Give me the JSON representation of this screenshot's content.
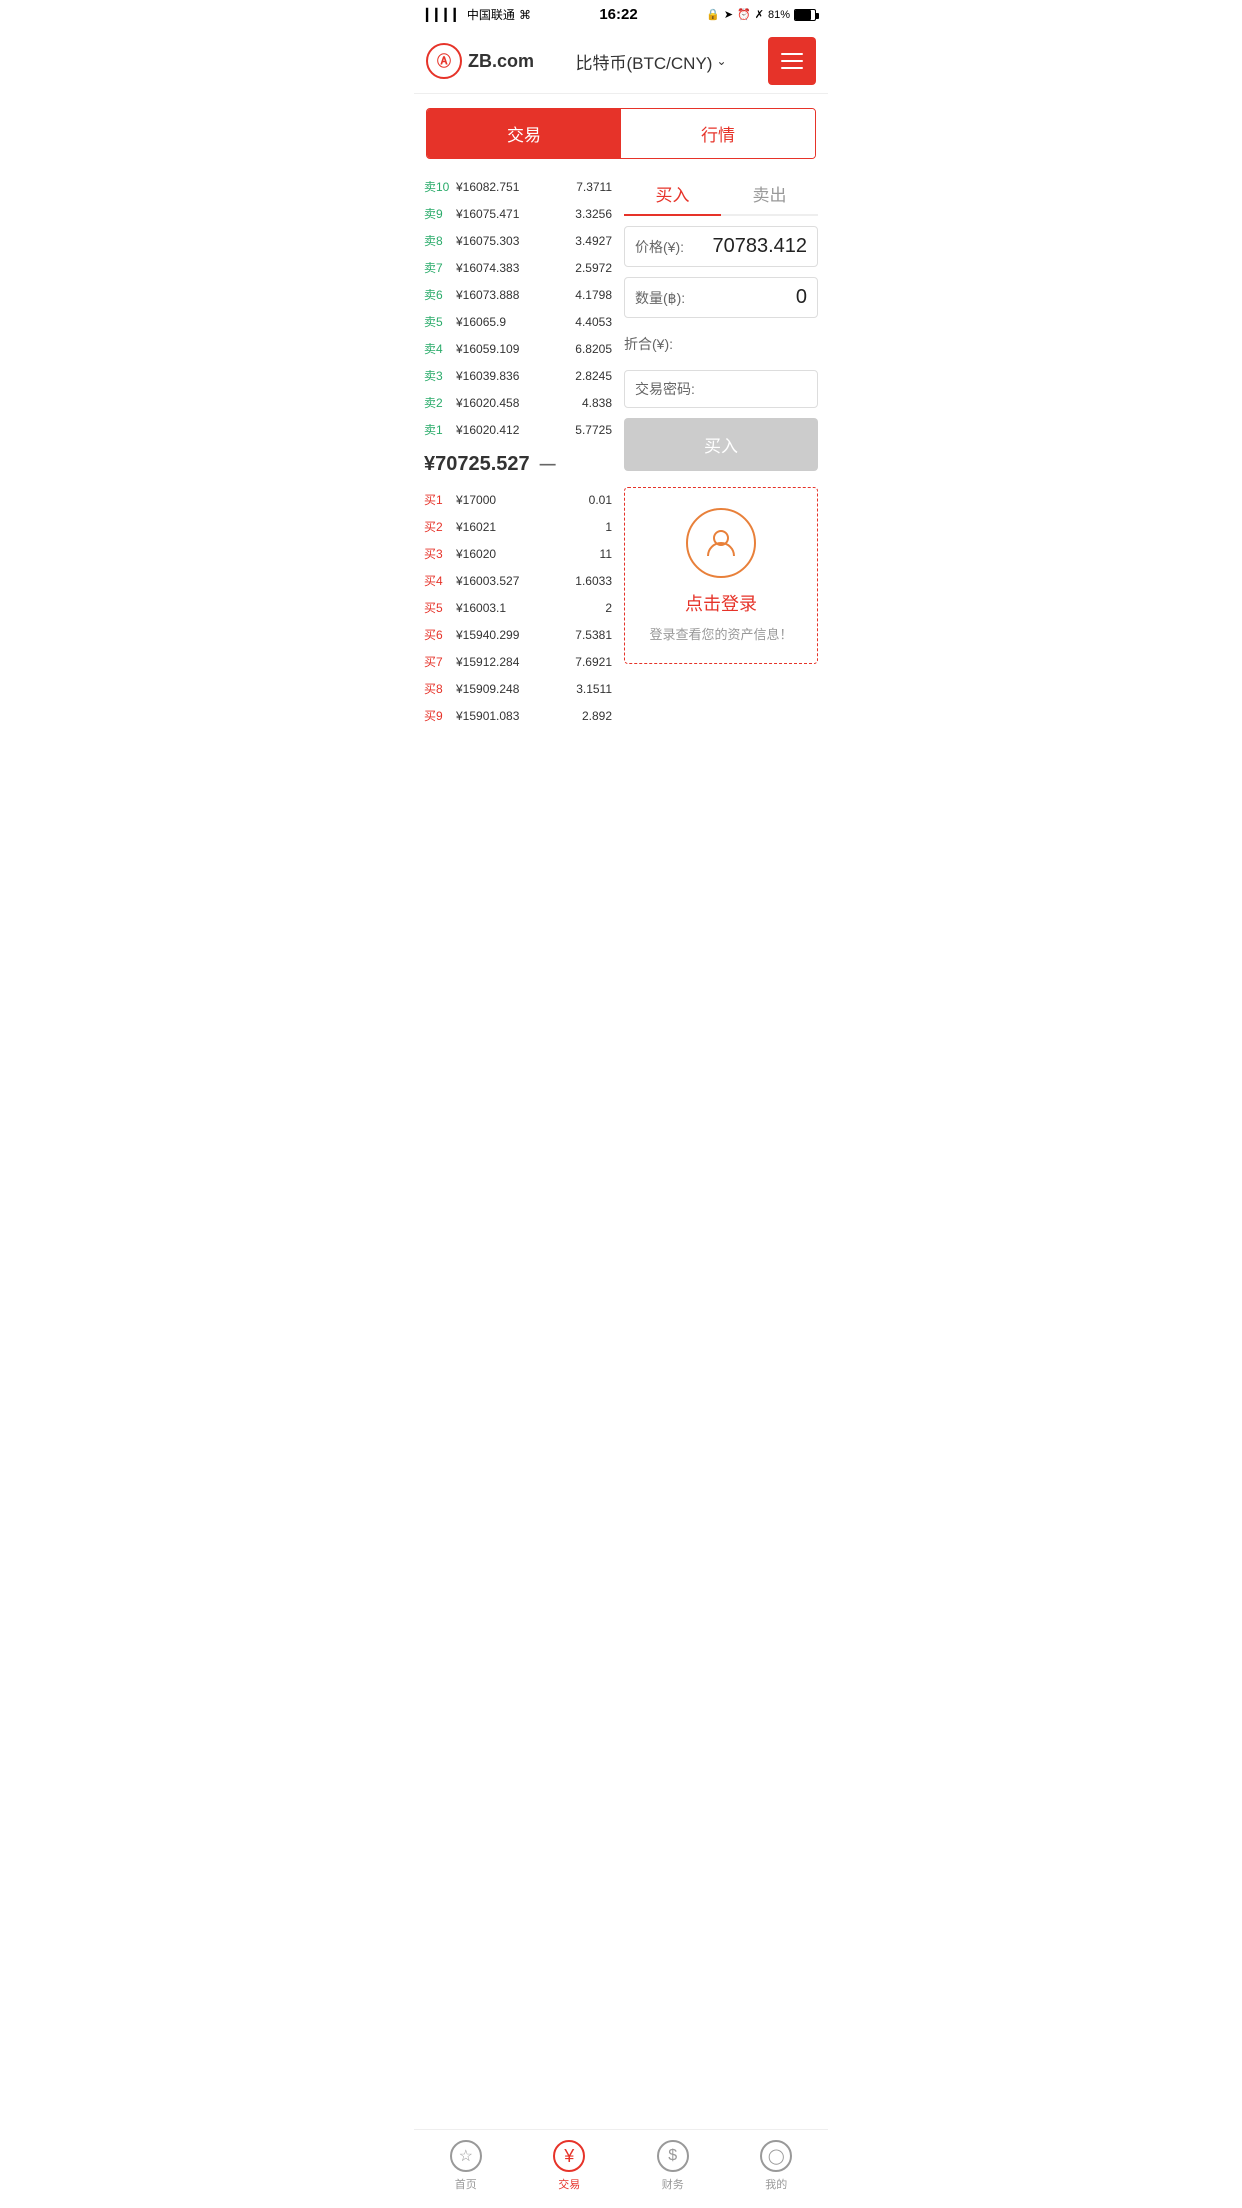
{
  "statusBar": {
    "carrier": "中国联通",
    "time": "16:22",
    "battery": "81%"
  },
  "header": {
    "logoText": "ZB",
    "logoDomain": ".com",
    "title": "比特币(BTC/CNY)",
    "menuLabel": "menu"
  },
  "tabs": {
    "trade": "交易",
    "market": "行情"
  },
  "sellOrders": [
    {
      "label": "卖10",
      "price": "¥16082.751",
      "qty": "7.3711"
    },
    {
      "label": "卖9",
      "price": "¥16075.471",
      "qty": "3.3256"
    },
    {
      "label": "卖8",
      "price": "¥16075.303",
      "qty": "3.4927"
    },
    {
      "label": "卖7",
      "price": "¥16074.383",
      "qty": "2.5972"
    },
    {
      "label": "卖6",
      "price": "¥16073.888",
      "qty": "4.1798"
    },
    {
      "label": "卖5",
      "price": "¥16065.9",
      "qty": "4.4053"
    },
    {
      "label": "卖4",
      "price": "¥16059.109",
      "qty": "6.8205"
    },
    {
      "label": "卖3",
      "price": "¥16039.836",
      "qty": "2.8245"
    },
    {
      "label": "卖2",
      "price": "¥16020.458",
      "qty": "4.838"
    },
    {
      "label": "卖1",
      "price": "¥16020.412",
      "qty": "5.7725"
    }
  ],
  "midPrice": {
    "value": "¥70725.527",
    "arrow": "—"
  },
  "buyOrders": [
    {
      "label": "买1",
      "price": "¥17000",
      "qty": "0.01"
    },
    {
      "label": "买2",
      "price": "¥16021",
      "qty": "1"
    },
    {
      "label": "买3",
      "price": "¥16020",
      "qty": "11"
    },
    {
      "label": "买4",
      "price": "¥16003.527",
      "qty": "1.6033"
    },
    {
      "label": "买5",
      "price": "¥16003.1",
      "qty": "2"
    },
    {
      "label": "买6",
      "price": "¥15940.299",
      "qty": "7.5381"
    },
    {
      "label": "买7",
      "price": "¥15912.284",
      "qty": "7.6921"
    },
    {
      "label": "买8",
      "price": "¥15909.248",
      "qty": "3.1511"
    },
    {
      "label": "买9",
      "price": "¥15901.083",
      "qty": "2.892"
    }
  ],
  "tradePanel": {
    "buyTab": "买入",
    "sellTab": "卖出",
    "priceLabel": "价格(¥):",
    "priceValue": "70783.412",
    "qtyLabel": "数量(฿):",
    "qtyValue": "0",
    "totalLabel": "折合(¥):",
    "totalValue": "",
    "passwordLabel": "交易密码:",
    "buyButton": "买入"
  },
  "loginArea": {
    "loginText": "点击登录",
    "loginDesc": "登录查看您的资产信息！"
  },
  "bottomNav": [
    {
      "label": "首页",
      "icon": "★",
      "active": false
    },
    {
      "label": "交易",
      "icon": "¥",
      "active": true
    },
    {
      "label": "财务",
      "icon": "💰",
      "active": false
    },
    {
      "label": "我的",
      "icon": "👤",
      "active": false
    }
  ]
}
